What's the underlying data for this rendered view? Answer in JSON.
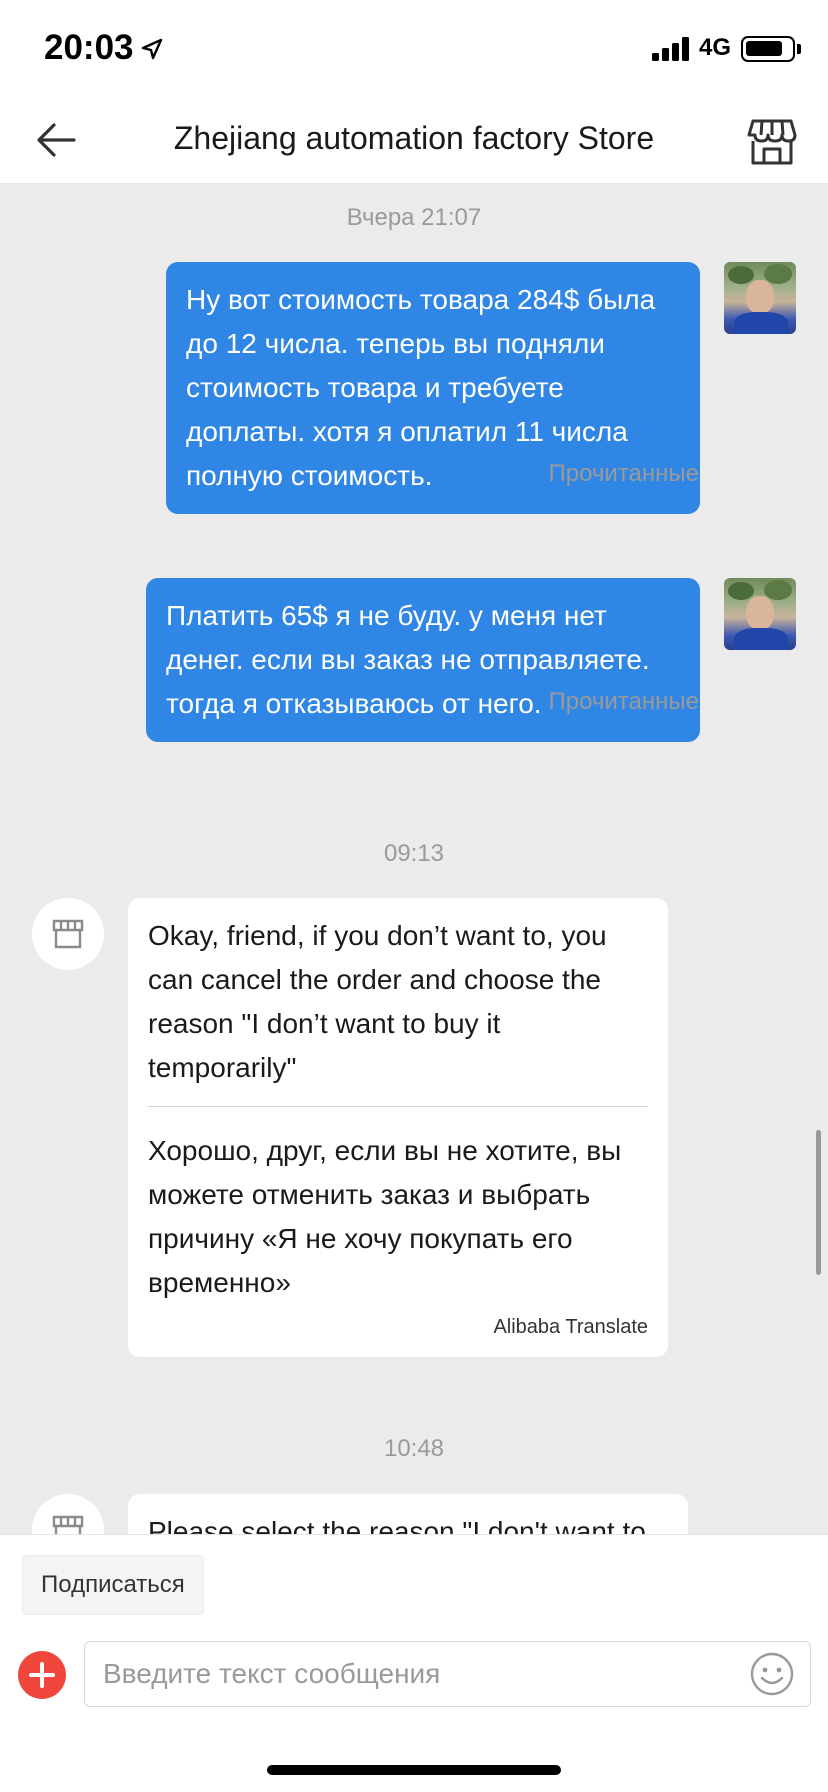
{
  "status_bar": {
    "time": "20:03",
    "network": "4G"
  },
  "header": {
    "title": "Zhejiang automation factory Store"
  },
  "messages": [
    {
      "type": "timestamp",
      "text": "Вчера 21:07"
    },
    {
      "type": "outgoing",
      "text": "Ну вот стоимость товара 284$ была до 12 числа. теперь вы подняли стоимость товара и требуете доплаты. хотя я оплатил 11 числа полную стоимость.",
      "status": "Прочитанные"
    },
    {
      "type": "outgoing",
      "text": "Платить 65$ я не буду. у меня нет денег. если вы заказ не отправляете. тогда я отказываюсь от него.",
      "status": "Прочитанные"
    },
    {
      "type": "timestamp",
      "text": "09:13"
    },
    {
      "type": "incoming",
      "original": "Okay, friend, if you don’t want to, you can cancel the order and choose the reason \"I don’t want to buy it temporarily\"",
      "translation": "Хорошо, друг, если вы не хотите, вы можете отменить заказ и выбрать причину «Я не хочу покупать его временно»",
      "translator": "Alibaba Translate"
    },
    {
      "type": "timestamp",
      "text": "10:48"
    },
    {
      "type": "incoming",
      "original": "Please select the reason \"I don't want to"
    }
  ],
  "footer": {
    "subscribe_label": "Подписаться",
    "input_placeholder": "Введите текст сообщения"
  },
  "icons": {
    "back": "back-arrow-icon",
    "store": "store-icon",
    "add": "plus-icon",
    "emoji": "emoji-icon",
    "location": "location-arrow-icon"
  },
  "colors": {
    "outgoing_bubble": "#2f86e4",
    "chat_background": "#ebebeb",
    "add_button": "#f0463c"
  }
}
